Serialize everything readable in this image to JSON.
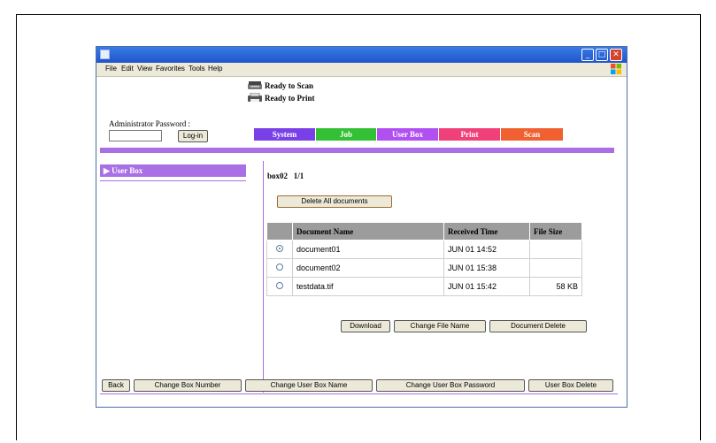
{
  "menu": [
    "File",
    "Edit",
    "View",
    "Favorites",
    "Tools",
    "Help"
  ],
  "status": {
    "scan": "Ready to Scan",
    "print": "Ready to Print"
  },
  "admin": {
    "label": "Administrator Password :",
    "password_value": "",
    "login_label": "Log-in"
  },
  "tabs": [
    {
      "label": "System",
      "color": "#7a40e8"
    },
    {
      "label": "Job",
      "color": "#34c034"
    },
    {
      "label": "User Box",
      "color": "#b050f0"
    },
    {
      "label": "Print",
      "color": "#f0407a"
    },
    {
      "label": "Scan",
      "color": "#f06030"
    }
  ],
  "sidebar": {
    "items": [
      {
        "label": "User Box",
        "selected": true
      }
    ]
  },
  "main": {
    "box_title": "box02   1/1",
    "delete_all_label": "Delete All documents",
    "table": {
      "headers": [
        "",
        "Document Name",
        "Received Time",
        "File Size"
      ],
      "rows": [
        {
          "selected": true,
          "name": "document01",
          "time": "JUN 01 14:52",
          "size": ""
        },
        {
          "selected": false,
          "name": "document02",
          "time": "JUN 01 15:38",
          "size": ""
        },
        {
          "selected": false,
          "name": "testdata.tif",
          "time": "JUN 01 15:42",
          "size": "58 KB"
        }
      ]
    },
    "actions": {
      "download": "Download",
      "change_name": "Change File Name",
      "doc_delete": "Document Delete"
    }
  },
  "footer": {
    "back": "Back",
    "change_box_number": "Change Box Number",
    "change_box_name": "Change User Box Name",
    "change_box_password": "Change User Box Password",
    "box_delete": "User Box Delete"
  },
  "colors": {
    "accent": "#a96fe4",
    "titlebar": "#2a66d8"
  }
}
